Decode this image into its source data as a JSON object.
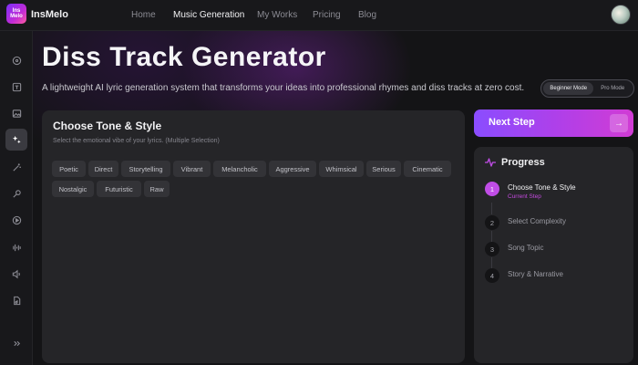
{
  "header": {
    "logo_lines": [
      "Ins",
      "Melo"
    ],
    "brand": "InsMelo",
    "nav": [
      {
        "label": "Home",
        "active": false
      },
      {
        "label": "Music Generation",
        "active": true
      },
      {
        "label": "My Works",
        "active": false
      },
      {
        "label": "Pricing",
        "active": false
      },
      {
        "label": "Blog",
        "active": false
      }
    ]
  },
  "sidebar": {
    "icons": [
      "disc-icon",
      "text-icon",
      "image-icon",
      "sparkles-icon",
      "magic-wand-icon",
      "microphone-icon",
      "play-circle-icon",
      "waveform-icon",
      "speaker-icon",
      "music-file-icon",
      "expand-icon"
    ],
    "active_index": 3
  },
  "hero": {
    "title": "Diss Track Generator",
    "subtitle": "A lightweight AI lyric generation system that transforms your ideas into professional rhymes and diss tracks at zero cost."
  },
  "mode": {
    "beginner": "Beginner Mode",
    "pro": "Pro Mode",
    "selected": "Beginner Mode"
  },
  "tone": {
    "title": "Choose Tone & Style",
    "subtitle": "Select the emotional vibe of your lyrics. (Multiple Selection)",
    "options": [
      "Poetic",
      "Direct",
      "Storytelling",
      "Vibrant",
      "Melancholic",
      "Aggressive",
      "Whimsical",
      "Serious",
      "Cinematic",
      "Nostalgic",
      "Futuristic",
      "Raw"
    ]
  },
  "next_step": {
    "label": "Next Step",
    "arrow": "→"
  },
  "progress": {
    "title": "Progress",
    "current_label": "Current Step",
    "steps": [
      {
        "num": "1",
        "label": "Choose Tone & Style",
        "active": true
      },
      {
        "num": "2",
        "label": "Select Complexity",
        "active": false
      },
      {
        "num": "3",
        "label": "Song Topic",
        "active": false
      },
      {
        "num": "4",
        "label": "Story & Narrative",
        "active": false
      }
    ]
  },
  "colors": {
    "accent": "#c04de6",
    "button_gradient_start": "#8a4dff",
    "button_gradient_end": "#d13cd4",
    "background": "#141416",
    "panel": "#252528"
  }
}
